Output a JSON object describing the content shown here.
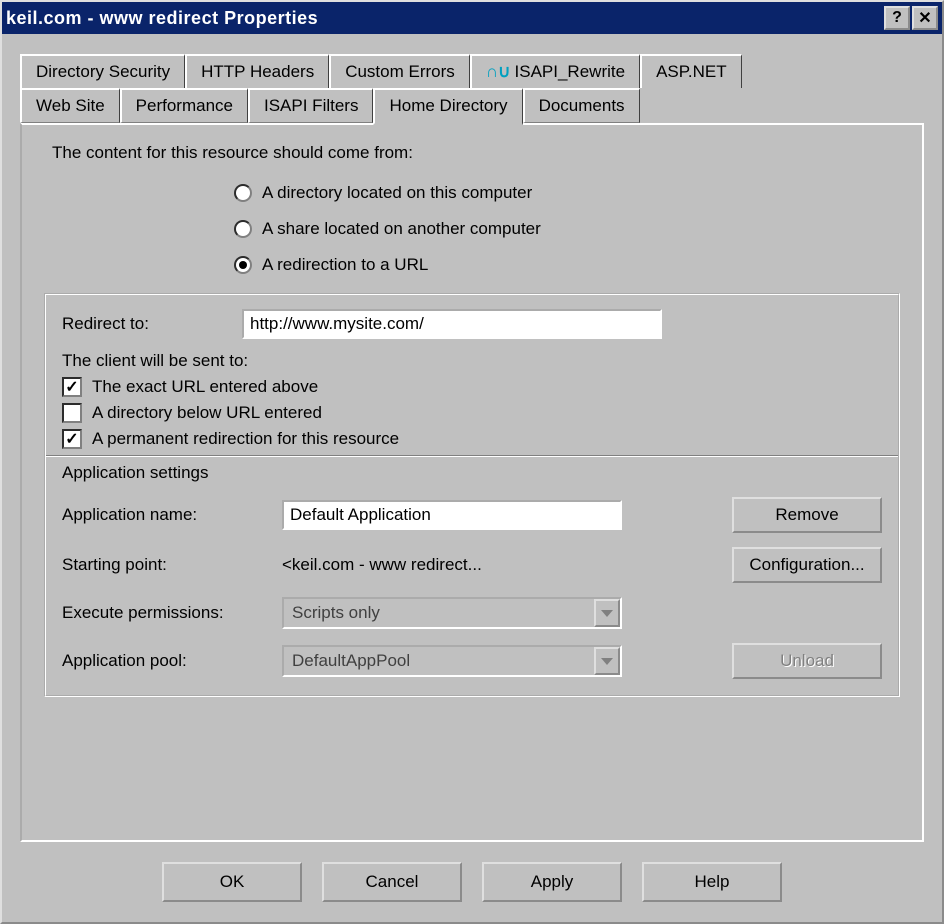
{
  "window": {
    "title": "keil.com - www redirect Properties"
  },
  "tabs": {
    "row1": [
      "Directory Security",
      "HTTP Headers",
      "Custom Errors",
      "ISAPI_Rewrite",
      "ASP.NET"
    ],
    "row2": [
      "Web Site",
      "Performance",
      "ISAPI Filters",
      "Home Directory",
      "Documents"
    ],
    "active": "Home Directory"
  },
  "content_source": {
    "heading": "The content for this resource should come from:",
    "options": [
      {
        "label": "A directory located on this computer",
        "checked": false
      },
      {
        "label": "A share located on another computer",
        "checked": false
      },
      {
        "label": "A redirection to a URL",
        "checked": true
      }
    ]
  },
  "redirect": {
    "label": "Redirect to:",
    "value": "http://www.mysite.com/",
    "client_heading": "The client will be sent to:",
    "checks": [
      {
        "label": "The exact URL entered above",
        "checked": true
      },
      {
        "label": "A directory below URL entered",
        "checked": false
      },
      {
        "label": "A permanent redirection for this resource",
        "checked": true
      }
    ]
  },
  "app": {
    "heading": "Application settings",
    "name_label": "Application name:",
    "name_value": "Default Application",
    "remove": "Remove",
    "start_label": "Starting point:",
    "start_value": "<keil.com - www redirect...",
    "config": "Configuration...",
    "exec_label": "Execute permissions:",
    "exec_value": "Scripts only",
    "pool_label": "Application pool:",
    "pool_value": "DefaultAppPool",
    "unload": "Unload"
  },
  "buttons": {
    "ok": "OK",
    "cancel": "Cancel",
    "apply": "Apply",
    "help": "Help"
  }
}
